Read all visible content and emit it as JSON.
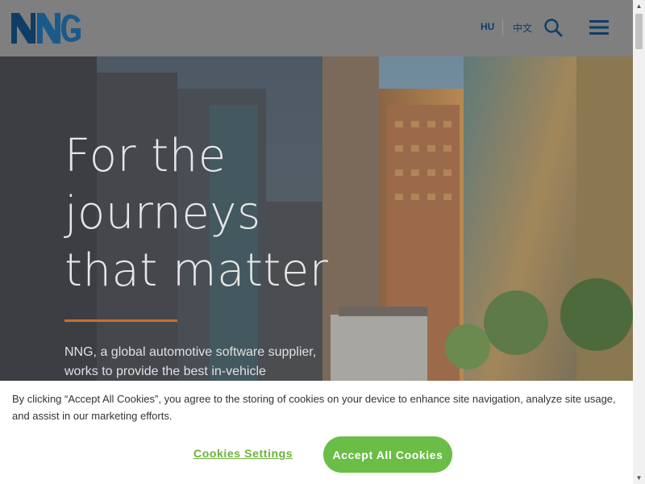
{
  "header": {
    "logo_text": "NNG",
    "lang_hu": "HU",
    "lang_cn": "中文"
  },
  "hero": {
    "headline_lines": [
      "For the",
      "journeys",
      "that matter"
    ],
    "intro": "NNG, a global automotive software supplier, works to provide the best in-vehicle"
  },
  "cookie": {
    "text": "By clicking “Accept All Cookies”, you agree to the storing of cookies on your device to enhance site navigation, analyze site usage, and assist in our marketing efforts.",
    "settings_label": "Cookies Settings",
    "accept_label": "Accept All Cookies"
  },
  "colors": {
    "brand_blue": "#0f3d66",
    "accent_orange": "#c8702c",
    "cookie_green": "#6abd45"
  },
  "icons": {
    "search": "search-icon",
    "menu": "hamburger-menu-icon",
    "scroll_up": "scroll-up-arrow-icon",
    "scroll_down": "scroll-down-arrow-icon"
  }
}
